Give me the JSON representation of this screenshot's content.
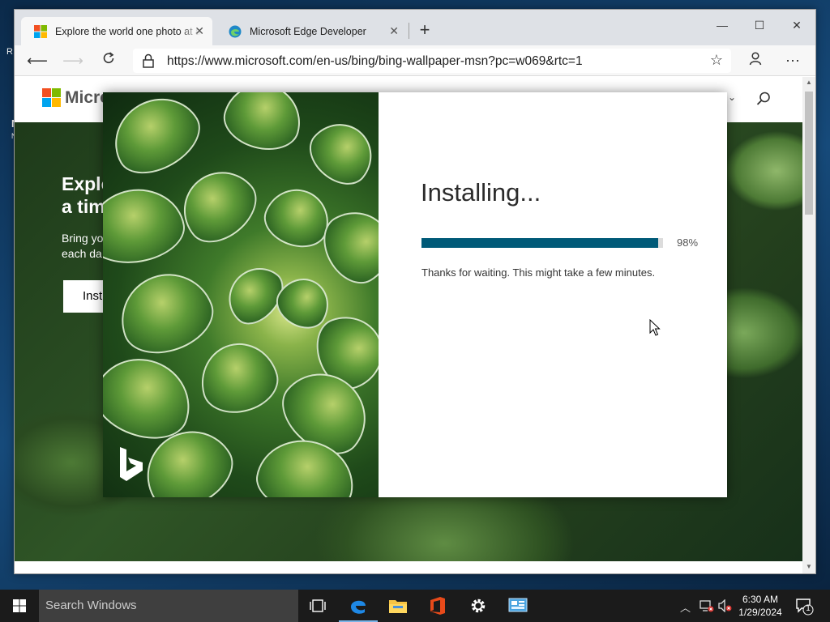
{
  "desktop": {
    "frag1": "R",
    "frag2": "N",
    "frag3": "N"
  },
  "browser": {
    "tabs": [
      {
        "title": "Explore the world one photo at a time",
        "active": true
      },
      {
        "title": "Microsoft Edge Developer",
        "active": false
      }
    ],
    "url": "https://www.microsoft.com/en-us/bing/bing-wallpaper-msn?pc=w069&rtc=1"
  },
  "page": {
    "brand": "Micro",
    "hero_title_line1": "Explo",
    "hero_title_line2": "a tim",
    "hero_sub_line1": "Bring yo",
    "hero_sub_line2": "each da",
    "hero_button": "Inst"
  },
  "installer": {
    "title": "Installing...",
    "progress_percent": 98,
    "progress_label": "98%",
    "message": "Thanks for waiting. This might take a few minutes."
  },
  "taskbar": {
    "search_placeholder": "Search Windows",
    "time": "6:30 AM",
    "date": "1/29/2024",
    "notification_count": "1"
  },
  "colors": {
    "progress": "#005a78",
    "taskbar": "#1b1b1b"
  }
}
